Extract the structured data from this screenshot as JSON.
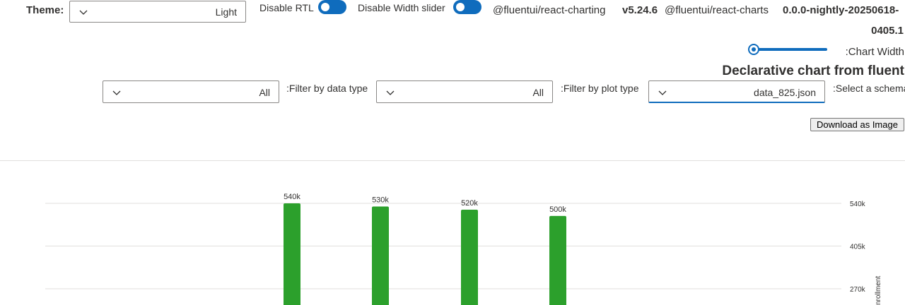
{
  "header": {
    "theme_label": "Theme:",
    "theme_value": "Light",
    "disable_rtl_label": "Disable RTL",
    "disable_width_slider_label": "Disable Width slider",
    "pkg1_name": "@fluentui/react-charting",
    "pkg1_version": "v5.24.6",
    "pkg2_name": "@fluentui/react-charts",
    "pkg2_version_line1": "0.0.0-nightly-20250618-",
    "pkg2_version_line2": "0405.1"
  },
  "width_slider": {
    "label": ":Chart Width",
    "value_fraction": 0.0
  },
  "page_title": "Declarative chart from fluent",
  "filters": {
    "data_type_value": "All",
    "data_type_label": ":Filter by data type",
    "plot_type_value": "All",
    "plot_type_label": ":Filter by plot type",
    "schema_value": "data_825.json",
    "schema_label": ":Select a schema"
  },
  "download_label": "Download as Image",
  "colors": {
    "bar": "#2ca02c",
    "accent": "#0f6cbd",
    "grid": "#e1dfdd"
  },
  "chart_data": {
    "type": "bar",
    "categories": [
      "",
      "",
      "",
      ""
    ],
    "values": [
      540000,
      530000,
      520000,
      500000
    ],
    "data_labels": [
      "540k",
      "530k",
      "520k",
      "500k"
    ],
    "y_ticks": [
      {
        "value": 540000,
        "label": "540k"
      },
      {
        "value": 405000,
        "label": "405k"
      },
      {
        "value": 270000,
        "label": "270k"
      }
    ],
    "ylabel": "nrollment",
    "y_axis_side": "right",
    "grid": true
  }
}
